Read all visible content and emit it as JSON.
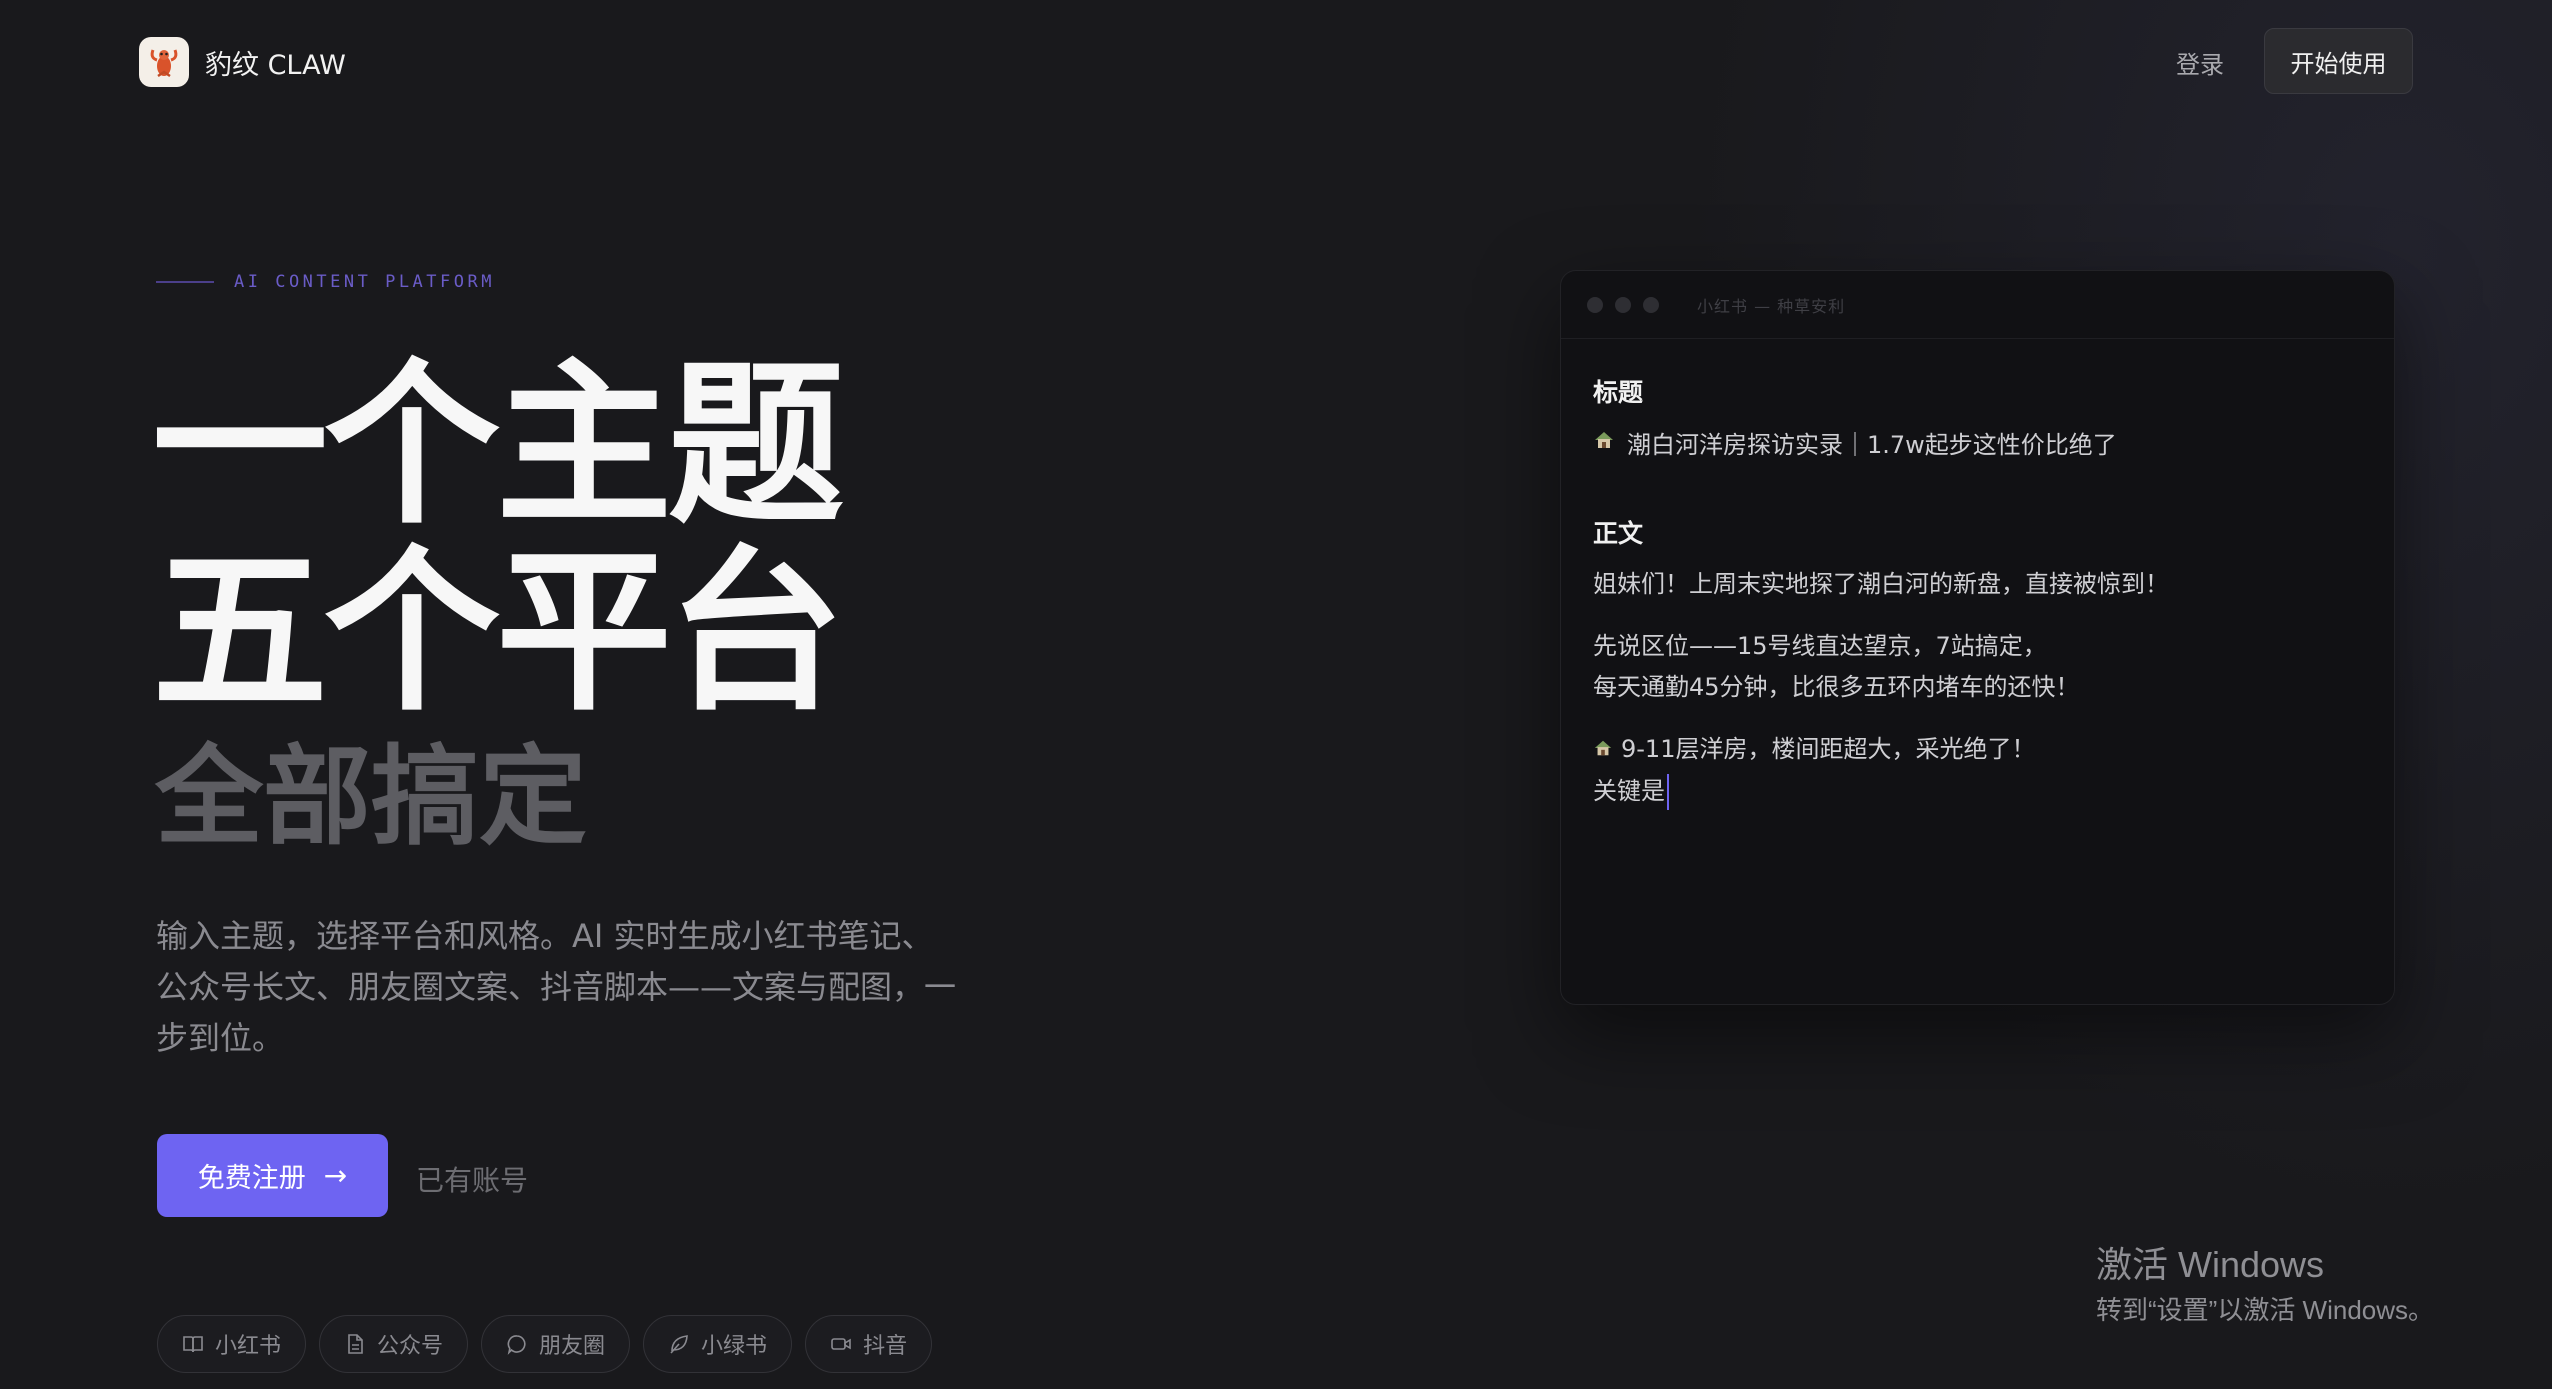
{
  "header": {
    "brand": "豹纹 CLAW",
    "login_label": "登录",
    "start_label": "开始使用"
  },
  "hero": {
    "eyebrow": "AI CONTENT PLATFORM",
    "line1": "一个主题",
    "line2": "五个平台",
    "line3": "全部搞定",
    "description": "输入主题，选择平台和风格。AI 实时生成小红书笔记、公众号长文、朋友圈文案、抖音脚本——文案与配图，一步到位。",
    "cta_label": "免费注册",
    "secondary_label": "已有账号"
  },
  "platforms": [
    {
      "label": "小红书",
      "icon": "book-icon"
    },
    {
      "label": "公众号",
      "icon": "document-icon"
    },
    {
      "label": "朋友圈",
      "icon": "chat-bubble-icon"
    },
    {
      "label": "小绿书",
      "icon": "leaf-icon"
    },
    {
      "label": "抖音",
      "icon": "video-icon"
    }
  ],
  "editor": {
    "window_title": "小红书 — 种草安利",
    "title_label": "标题",
    "title_text": "潮白河洋房探访实录｜1.7w起步这性价比绝了",
    "body_label": "正文",
    "paragraphs": [
      [
        "姐妹们！上周末实地探了潮白河的新盘，直接被惊到！"
      ],
      [
        "先说区位——15号线直达望京，7站搞定，",
        "每天通勤45分钟，比很多五环内堵车的还快！"
      ],
      [
        "9-11层洋房，楼间距超大，采光绝了！",
        "关键是"
      ]
    ]
  },
  "watermark": {
    "line1": "激活 Windows",
    "line2": "转到“设置”以激活 Windows。"
  },
  "colors": {
    "background": "#19191c",
    "accent": "#6e64f2",
    "panel": "#111114"
  }
}
